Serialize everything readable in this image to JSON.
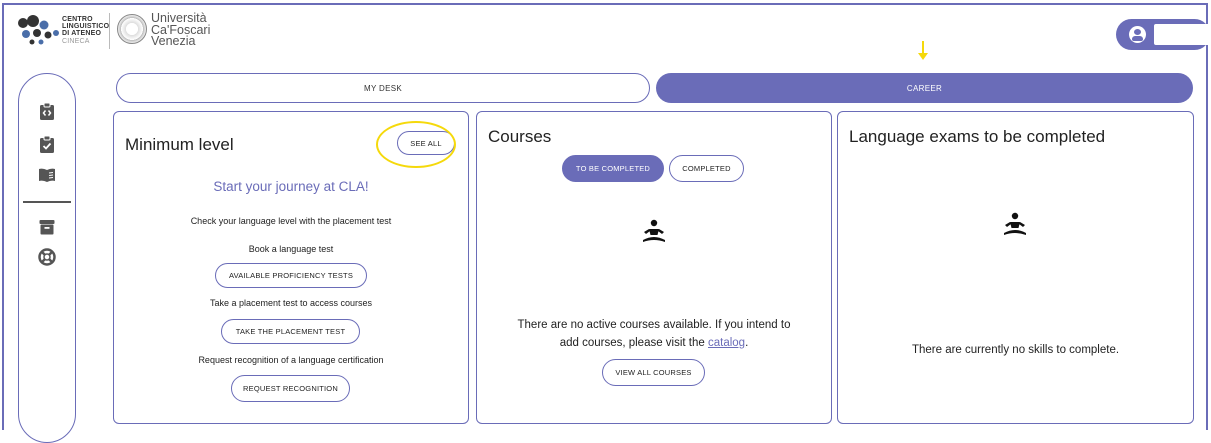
{
  "header": {
    "cla_lines": [
      "CENTRO",
      "LINGUISTICO",
      "DI ATENEO"
    ],
    "cla_sub": "CINECA",
    "university_lines": [
      "Università",
      "Ca'Foscari",
      "Venezia"
    ]
  },
  "sidebar": {
    "items": [
      {
        "icon": "clipboard-code-icon"
      },
      {
        "icon": "clipboard-check-icon"
      },
      {
        "icon": "book-icon"
      },
      {
        "icon": "archive-icon"
      },
      {
        "icon": "lifebuoy-icon"
      }
    ]
  },
  "tabs": [
    {
      "label": "MY DESK",
      "active": false
    },
    {
      "label": "CAREER",
      "active": true
    }
  ],
  "minimum_level": {
    "title": "Minimum level",
    "see_all": "SEE ALL",
    "journey": "Start your journey at CLA!",
    "check_text": "Check your language level with the placement test",
    "book_text": "Book a language test",
    "proficiency_button": "AVAILABLE PROFICIENCY TESTS",
    "placement_text": "Take a placement test to access courses",
    "placement_button": "TAKE THE PLACEMENT TEST",
    "recognition_text": "Request recognition of a language certification",
    "recognition_button": "REQUEST RECOGNITION"
  },
  "courses": {
    "title": "Courses",
    "tab_to_complete": "TO BE COMPLETED",
    "tab_completed": "COMPLETED",
    "empty_line1": "There are no active courses available. If you intend to",
    "empty_line2_prefix": "add courses, please visit the ",
    "catalog_link": "catalog",
    "empty_line2_suffix": ".",
    "view_all": "VIEW ALL COURSES"
  },
  "exams": {
    "title": "Language exams to be completed",
    "empty_text": "There are currently no skills to complete."
  },
  "colors": {
    "accent": "#6a6cb8",
    "highlight": "#f5d90b"
  }
}
